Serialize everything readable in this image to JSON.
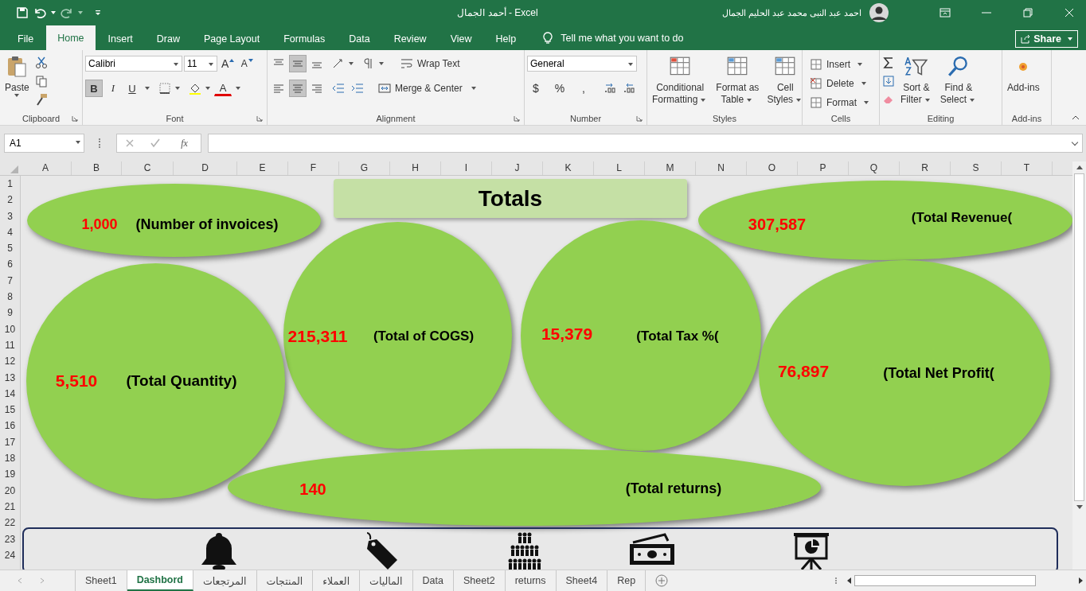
{
  "window": {
    "title": "أحمد الجمال  -  Excel",
    "user": "احمد عبد النبى محمد عبد الحليم الجمال"
  },
  "menu_tabs": [
    {
      "label": "File",
      "selected": false
    },
    {
      "label": "Home",
      "selected": true
    },
    {
      "label": "Insert",
      "selected": false
    },
    {
      "label": "Draw",
      "selected": false
    },
    {
      "label": "Page Layout",
      "selected": false
    },
    {
      "label": "Formulas",
      "selected": false
    },
    {
      "label": "Data",
      "selected": false
    },
    {
      "label": "Review",
      "selected": false
    },
    {
      "label": "View",
      "selected": false
    },
    {
      "label": "Help",
      "selected": false
    }
  ],
  "tell_me": "Tell me what you want to do",
  "share": "Share",
  "ribbon": [
    {
      "kind": "clipboard",
      "label": "Clipboard",
      "paste": "Paste"
    },
    {
      "kind": "font",
      "label": "Font",
      "font_name": "Calibri",
      "font_size": "11",
      "grow": "A",
      "shrink": "A",
      "styles": [
        {
          "label": "B",
          "selected": true
        },
        {
          "label": "I",
          "selected": false
        },
        {
          "label": "U",
          "selected": false
        }
      ],
      "font_color": "A"
    },
    {
      "kind": "alignment",
      "label": "Alignment",
      "vertical": [
        {
          "selected": false
        },
        {
          "selected": true
        },
        {
          "selected": false
        }
      ],
      "horizontal": [
        {
          "selected": false
        },
        {
          "selected": true
        },
        {
          "selected": false
        }
      ],
      "wrap": "Wrap Text",
      "merge": "Merge & Center"
    },
    {
      "kind": "number",
      "label": "Number",
      "format": "General",
      "buttons": [
        "$",
        "%",
        ","
      ]
    },
    {
      "kind": "large",
      "label": "Styles",
      "items": [
        {
          "lines": [
            "Conditional",
            "Formatting"
          ]
        },
        {
          "lines": [
            "Format as",
            "Table"
          ]
        },
        {
          "lines": [
            "Cell",
            "Styles"
          ]
        }
      ]
    },
    {
      "kind": "cells",
      "label": "Cells",
      "items": [
        "Insert",
        "Delete",
        "Format"
      ]
    },
    {
      "kind": "editing",
      "label": "Editing",
      "items": [
        {
          "lines": [
            "Sort &",
            "Filter"
          ]
        },
        {
          "lines": [
            "Find &",
            "Select"
          ]
        }
      ]
    },
    {
      "kind": "addins",
      "label": "Add-ins",
      "button": "Add-ins"
    }
  ],
  "formula_bar": {
    "name_box": "A1",
    "function_label": "fx"
  },
  "columns": [
    "A",
    "B",
    "C",
    "D",
    "E",
    "F",
    "G",
    "H",
    "I",
    "J",
    "K",
    "L",
    "M",
    "N",
    "O",
    "P",
    "Q",
    "R",
    "S",
    "T"
  ],
  "rows": [
    "1",
    "2",
    "3",
    "4",
    "5",
    "6",
    "7",
    "8",
    "9",
    "10",
    "11",
    "12",
    "13",
    "14",
    "15",
    "16",
    "17",
    "18",
    "19",
    "20",
    "21",
    "22",
    "23",
    "24"
  ],
  "dashboard": [
    {
      "kind": "ellipse",
      "amount": "1,000",
      "caption": "(Number of invoices)"
    },
    {
      "kind": "title",
      "caption": "Totals"
    },
    {
      "kind": "ellipse",
      "amount": "307,587",
      "caption": "(Total Revenue("
    },
    {
      "kind": "ellipse",
      "amount": "215,311",
      "caption": "(Total of COGS)"
    },
    {
      "kind": "ellipse",
      "amount": "15,379",
      "caption": "(Total Tax %("
    },
    {
      "kind": "ellipse",
      "amount": "5,510",
      "caption": "(Total Quantity)"
    },
    {
      "kind": "ellipse",
      "amount": "76,897",
      "caption": "(Total Net Profit("
    },
    {
      "kind": "ellipse",
      "amount": "140",
      "caption": "(Total returns)"
    }
  ],
  "sheet_tabs": [
    {
      "label": "Sheet1",
      "selected": false
    },
    {
      "label": "Dashbord",
      "selected": true
    },
    {
      "label": "المرتجعات",
      "selected": false
    },
    {
      "label": "المنتجات",
      "selected": false
    },
    {
      "label": "العملاء",
      "selected": false
    },
    {
      "label": "الماليات",
      "selected": false
    },
    {
      "label": "Data",
      "selected": false
    },
    {
      "label": "Sheet2",
      "selected": false
    },
    {
      "label": "returns",
      "selected": false
    },
    {
      "label": "Sheet4",
      "selected": false
    },
    {
      "label": "Rep",
      "selected": false
    }
  ]
}
